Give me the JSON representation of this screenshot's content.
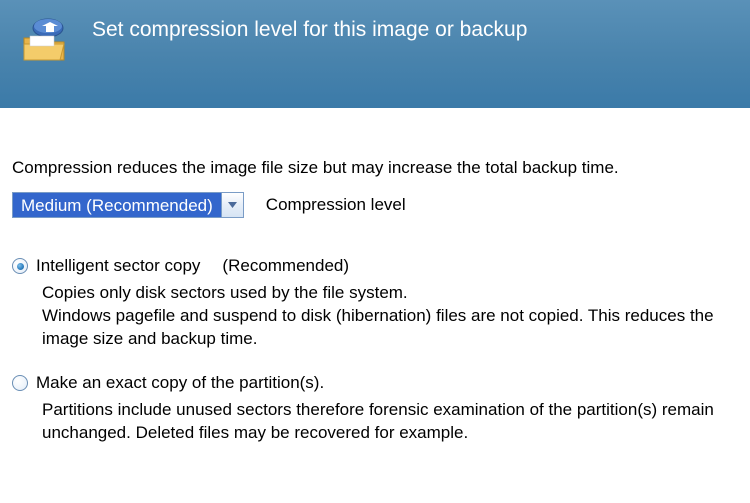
{
  "header": {
    "title": "Set compression level for this image or backup"
  },
  "intro": "Compression reduces the image file size but may increase the total backup time.",
  "compression": {
    "selected": "Medium (Recommended)",
    "label": "Compression level"
  },
  "options": [
    {
      "label": "Intelligent sector copy",
      "recommended": "(Recommended)",
      "selected": true,
      "description": "Copies only disk sectors used by the file system.\nWindows pagefile and suspend to disk (hibernation) files are not copied. This reduces the image size and backup time."
    },
    {
      "label": "Make an exact copy of the partition(s).",
      "recommended": "",
      "selected": false,
      "description": "Partitions include unused sectors therefore forensic examination of the partition(s) remain unchanged. Deleted files may be recovered for example."
    }
  ]
}
